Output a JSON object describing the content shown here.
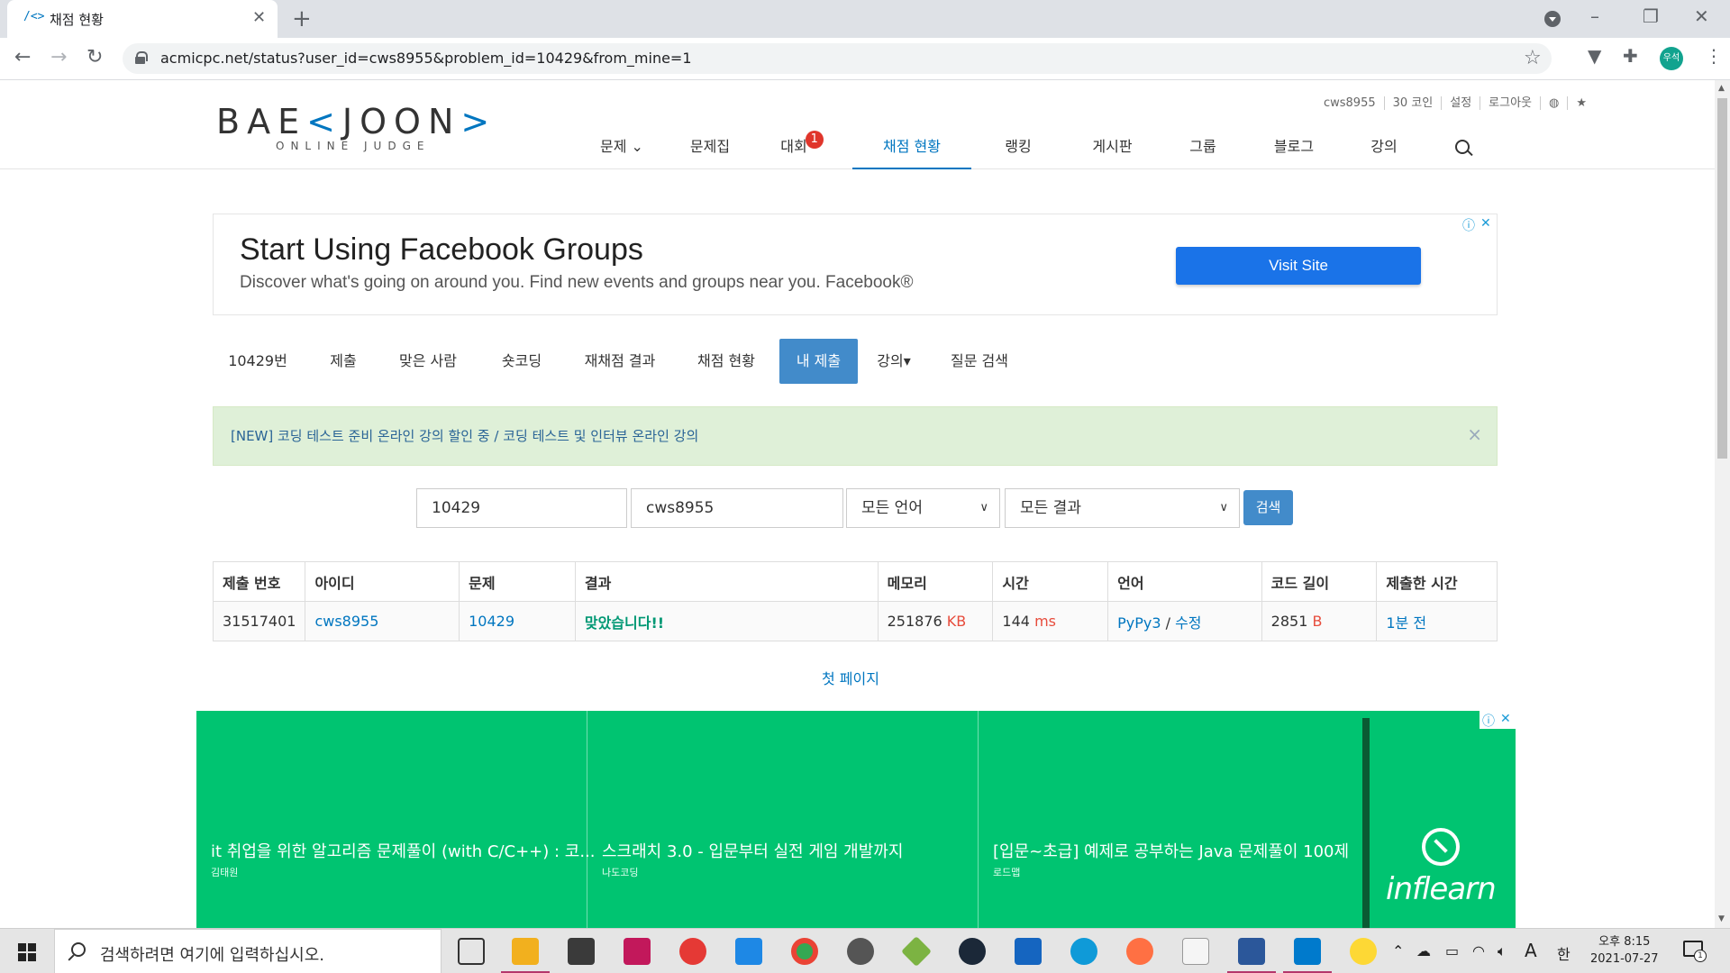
{
  "browser": {
    "tab_title": "채점 현황",
    "tab_favicon": "/<>",
    "url": "acmicpc.net/status?user_id=cws8955&problem_id=10429&from_mine=1",
    "profile_initials": "우석"
  },
  "site": {
    "logo_main_left": "BAE",
    "logo_main_acc1": "<",
    "logo_main_mid": "JOON",
    "logo_main_acc2": ">",
    "logo_sub": "ONLINE JUDGE",
    "topmenu": {
      "username": "cws8955",
      "coins": "30 코인",
      "settings": "설정",
      "logout": "로그아웃"
    },
    "nav": [
      {
        "label": "문제 ⌄"
      },
      {
        "label": "문제집"
      },
      {
        "label": "대회",
        "badge": "1"
      },
      {
        "label": "채점 현황"
      },
      {
        "label": "랭킹"
      },
      {
        "label": "게시판"
      },
      {
        "label": "그룹"
      },
      {
        "label": "블로그"
      },
      {
        "label": "강의"
      }
    ]
  },
  "ad_top": {
    "title": "Start Using Facebook Groups",
    "desc": "Discover what's going on around you. Find new events and groups near you. Facebook®",
    "button": "Visit Site"
  },
  "problem_tabs": [
    {
      "label": "10429번"
    },
    {
      "label": "제출"
    },
    {
      "label": "맞은 사람"
    },
    {
      "label": "숏코딩"
    },
    {
      "label": "재채점 결과"
    },
    {
      "label": "채점 현황"
    },
    {
      "label": "내 제출"
    },
    {
      "label": "강의▾"
    },
    {
      "label": "질문 검색"
    }
  ],
  "notice": {
    "text": "[NEW] 코딩 테스트 준비 온라인 강의 할인 중 / 코딩 테스트 및 인터뷰 온라인 강의"
  },
  "filters": {
    "problem_id": "10429",
    "user_id": "cws8955",
    "language": "모든 언어",
    "result": "모든 결과",
    "search_button": "검색"
  },
  "table": {
    "headers": [
      "제출 번호",
      "아이디",
      "문제",
      "결과",
      "메모리",
      "시간",
      "언어",
      "코드 길이",
      "제출한 시간"
    ],
    "row": {
      "submission_id": "31517401",
      "user": "cws8955",
      "problem": "10429",
      "result": "맞았습니다!!",
      "memory": "251876",
      "memory_unit": "KB",
      "time": "144",
      "time_unit": "ms",
      "language": "PyPy3",
      "lang_sep": " / ",
      "edit": "수정",
      "code_length": "2851",
      "code_unit": "B",
      "submitted": "1분 전"
    }
  },
  "first_page": "첫 페이지",
  "ad_bottom": {
    "courses": [
      {
        "title": "it 취업을 위한 알고리즘 문제풀이 (with C/C++) : 코...",
        "author": "김태원"
      },
      {
        "title": "스크래치 3.0 - 입문부터 실전 게임 개발까지",
        "author": "나도코딩"
      },
      {
        "title": "[입문~초급] 예제로 공부하는 Java 문제풀이 100제",
        "author": "로드맵"
      }
    ],
    "brand": "inflearn"
  },
  "taskbar": {
    "search_placeholder": "검색하려면 여기에 입력하십시오.",
    "time": "오후 8:15",
    "date": "2021-07-27",
    "ime_mode": "A",
    "ime_lang": "한",
    "notification_count": "1"
  }
}
